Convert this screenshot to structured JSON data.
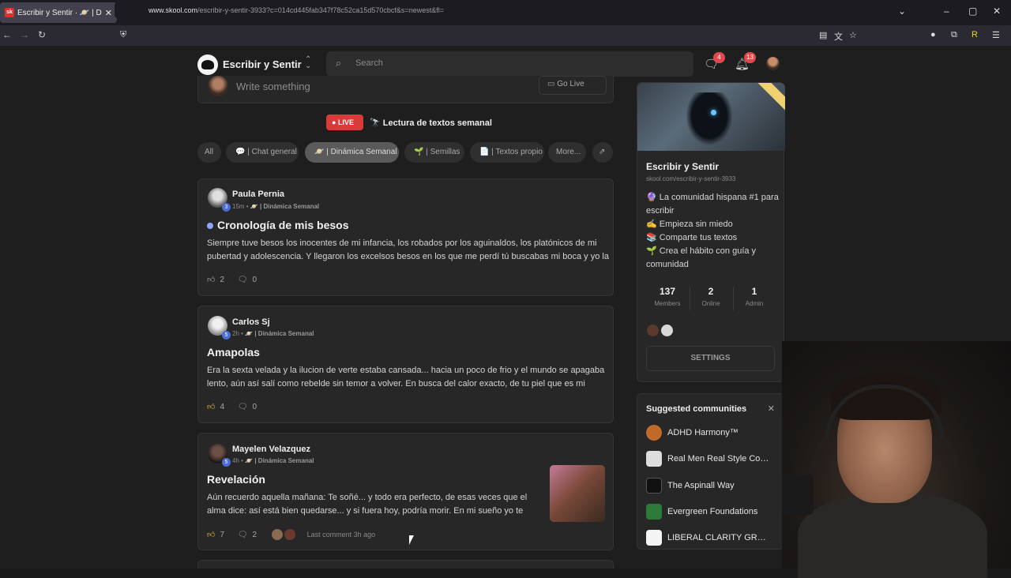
{
  "browser": {
    "tab_title": "Escribir y Sentir · 🪐 | Dinámica",
    "url_domain": "www.skool.com",
    "url_path": "/escribir-y-sentir-3933?c=014cd445fab347f78c52ca15d570cbcf&s=newest&fl="
  },
  "nav": {
    "community_name": "Escribir y Sentir",
    "search_placeholder": "Search",
    "chat_badge": "4",
    "notif_badge": "13"
  },
  "composer": {
    "placeholder": "Write something",
    "go_live": "Go Live"
  },
  "live": {
    "pill": "LIVE",
    "text": "🔭 Lectura de textos semanal"
  },
  "filters": [
    "All",
    "💬 | Chat general",
    "🪐 | Dinámica Semanal",
    "🌱 | Semillas",
    "📄 | Textos propio",
    "More...",
    "⇗"
  ],
  "posts": [
    {
      "author": "Paula Pernia",
      "level": "3",
      "time": "15m",
      "category": "🪐 | Dinámica Semanal",
      "title": "Cronología de mis besos",
      "body": "Siempre tuve besos los inocentes de mi infancia, los robados por los aguinaldos, los platónicos de mi pubertad y adolescencia. Y llegaron los excelsos besos en los que me perdí tú buscabas mi boca y yo la",
      "likes": "2",
      "comments": "0"
    },
    {
      "author": "Carlos Sj",
      "level": "5",
      "time": "2h",
      "category": "🪐 | Dinámica Semanal",
      "title": "Amapolas",
      "body": "Era la sexta velada y la ilucion de verte estaba cansada... hacia un poco de frio y el mundo se apagaba lento, aún así salí como rebelde sin temor a volver. En busca del calor exacto, de tu piel que es mi",
      "likes": "4",
      "comments": "0"
    },
    {
      "author": "Mayelen Velazquez",
      "level": "5",
      "time": "4h",
      "category": "🪐 | Dinámica Semanal",
      "title": "Revelación",
      "body": "Aún recuerdo aquella mañana: Te soñé... y todo era perfecto, de esas veces que el alma dice: así está bien quedarse... y si fuera hoy, podría morir. En mi sueño yo te",
      "likes": "7",
      "comments": "2",
      "last_comment": "Last comment 3h ago"
    }
  ],
  "sidebar": {
    "name": "Escribir y Sentir",
    "url": "skool.com/escribir-y-sentir-3933",
    "desc": [
      "🔮 La comunidad hispana #1 para escribir",
      "✍️ Empieza sin miedo",
      "📚 Comparte tus textos",
      "🌱 Crea el hábito con guía y comunidad"
    ],
    "stats": [
      {
        "n": "137",
        "l": "Members"
      },
      {
        "n": "2",
        "l": "Online"
      },
      {
        "n": "1",
        "l": "Admin"
      }
    ],
    "settings": "SETTINGS"
  },
  "suggested": {
    "title": "Suggested communities",
    "items": [
      "ADHD Harmony™",
      "Real Men Real Style Com...",
      "The Aspinall Way",
      "Evergreen Foundations",
      "LIBERAL CLARITY GROUP"
    ]
  }
}
